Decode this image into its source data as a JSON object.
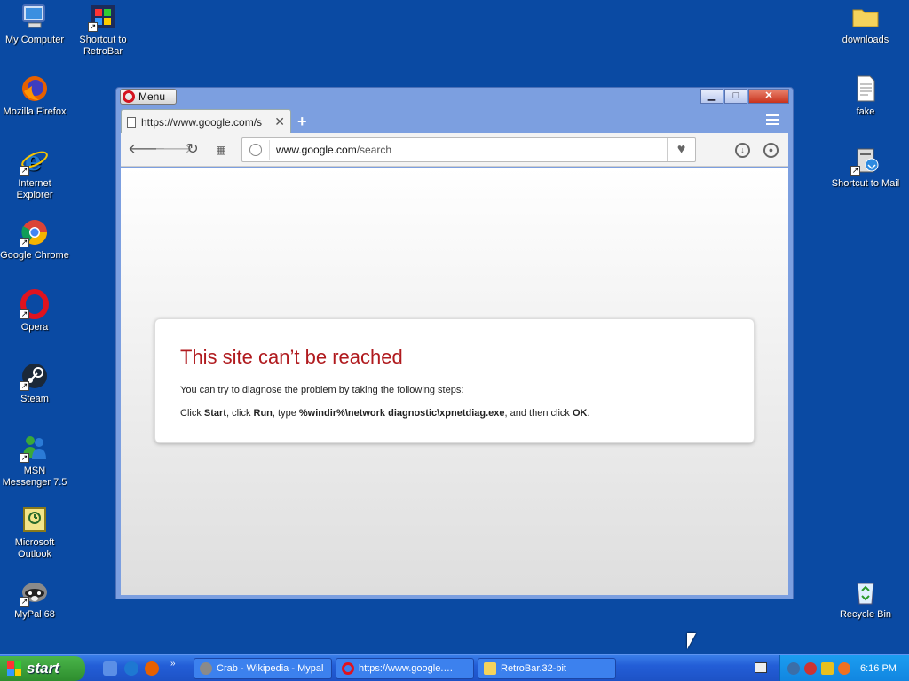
{
  "desktop": {
    "left_icons": [
      {
        "label": "My Computer",
        "icon": "computer-icon"
      },
      {
        "label": "Shortcut to RetroBar",
        "icon": "retrobar-icon"
      },
      {
        "label": "Mozilla Firefox",
        "icon": "firefox-icon"
      },
      {
        "label": "Internet Explorer",
        "icon": "ie-icon"
      },
      {
        "label": "Google Chrome",
        "icon": "chrome-icon"
      },
      {
        "label": "Opera",
        "icon": "opera-icon"
      },
      {
        "label": "Steam",
        "icon": "steam-icon"
      },
      {
        "label": "MSN Messenger 7.5",
        "icon": "msn-icon"
      },
      {
        "label": "Microsoft Outlook",
        "icon": "outlook-icon"
      },
      {
        "label": "MyPal 68",
        "icon": "mypal-icon"
      }
    ],
    "right_icons": [
      {
        "label": "downloads",
        "icon": "folder-icon"
      },
      {
        "label": "fake",
        "icon": "text-file-icon"
      },
      {
        "label": "Shortcut to Mail",
        "icon": "mail-icon"
      },
      {
        "label": "Recycle Bin",
        "icon": "recycle-bin-icon"
      }
    ]
  },
  "browser": {
    "menu_label": "Menu",
    "tab_title": "https://www.google.com/s",
    "address": {
      "host": "www.google.com",
      "path": "/search"
    },
    "error": {
      "title": "This site can’t be reached",
      "line1": "You can try to diagnose the problem by taking the following steps:",
      "line2": {
        "p1": "Click ",
        "start": "Start",
        "p2": ", click ",
        "run": "Run",
        "p3": ", type ",
        "cmd": "%windir%\\network diagnostic\\xpnetdiag.exe",
        "p4": ", and then click ",
        "ok": "OK",
        "p5": "."
      }
    }
  },
  "taskbar": {
    "start_label": "start",
    "items": [
      {
        "label": "Crab - Wikipedia - Mypal",
        "icon": "mypal-icon"
      },
      {
        "label": "https://www.google.…",
        "icon": "opera-icon"
      },
      {
        "label": "RetroBar.32-bit",
        "icon": "folder-icon"
      }
    ],
    "clock": "6:16 PM"
  },
  "colors": {
    "desktop_bg": "#0a4aa3",
    "error_title": "#b01a1e",
    "taskbar": "#235ed7"
  }
}
